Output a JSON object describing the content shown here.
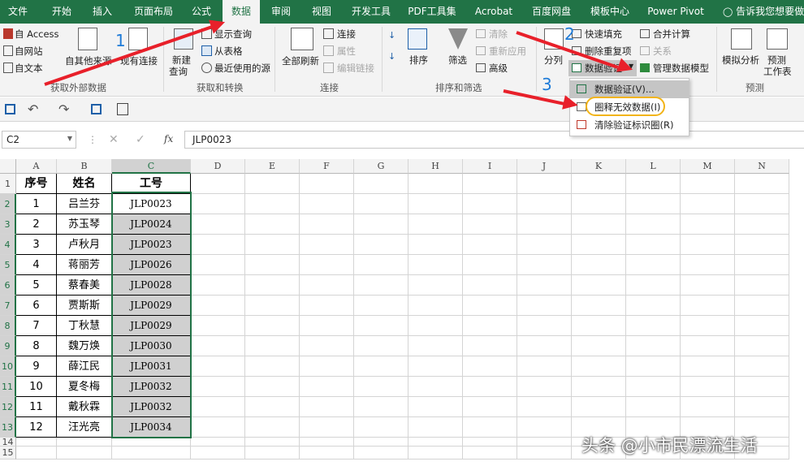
{
  "tabs": [
    "文件",
    "开始",
    "插入",
    "页面布局",
    "公式",
    "数据",
    "审阅",
    "视图",
    "开发工具",
    "PDF工具集",
    "Acrobat",
    "百度网盘",
    "模板中心",
    "Power Pivot",
    "告诉我您想要做什"
  ],
  "ribbon": {
    "access": "自 Access",
    "web": "自网站",
    "text": "自文本",
    "other_sources": "自其他来源",
    "existing_conn": "现有连接",
    "group_external": "获取外部数据",
    "new_query": "新建",
    "new_query2": "查询",
    "show_query": "显示查询",
    "from_table": "从表格",
    "recent_sources": "最近使用的源",
    "group_transform": "获取和转换",
    "refresh_all": "全部刷新",
    "connections": "连接",
    "properties": "属性",
    "edit_links": "编辑链接",
    "group_connections": "连接",
    "sort": "排序",
    "filter": "筛选",
    "clear": "清除",
    "reapply": "重新应用",
    "advanced": "高级",
    "group_sort_filter": "排序和筛选",
    "split": "分列",
    "flash_fill": "快速填充",
    "remove_dup": "删除重复项",
    "data_validation": "数据验证",
    "consolidate": "合并计算",
    "relationships": "关系",
    "manage_model": "管理数据模型",
    "what_if": "模拟分析",
    "forecast": "预测",
    "forecast_sheet": "工作表",
    "group_forecast": "预测"
  },
  "dropdown": {
    "item1": "数据验证(V)...",
    "item2": "圈释无效数据(I)",
    "item3": "清除验证标识圈(R)"
  },
  "formula_bar": {
    "name_box": "C2",
    "fx": "fx",
    "value": "JLP0023"
  },
  "columns": [
    "A",
    "B",
    "C",
    "D",
    "E",
    "F",
    "G",
    "H",
    "I",
    "J",
    "K",
    "L",
    "M",
    "N"
  ],
  "rows": [
    "1",
    "2",
    "3",
    "4",
    "5",
    "6",
    "7",
    "8",
    "9",
    "10",
    "11",
    "12",
    "13",
    "14",
    "15"
  ],
  "table": {
    "headers": [
      "序号",
      "姓名",
      "工号"
    ],
    "data": [
      [
        "1",
        "吕兰芬",
        "JLP0023"
      ],
      [
        "2",
        "苏玉琴",
        "JLP0024"
      ],
      [
        "3",
        "卢秋月",
        "JLP0023"
      ],
      [
        "4",
        "蒋丽芳",
        "JLP0026"
      ],
      [
        "5",
        "蔡春美",
        "JLP0028"
      ],
      [
        "6",
        "贾斯斯",
        "JLP0029"
      ],
      [
        "7",
        "丁秋慧",
        "JLP0029"
      ],
      [
        "8",
        "魏万焕",
        "JLP0030"
      ],
      [
        "9",
        "薛江民",
        "JLP0031"
      ],
      [
        "10",
        "夏冬梅",
        "JLP0032"
      ],
      [
        "11",
        "戴秋霖",
        "JLP0032"
      ],
      [
        "12",
        "汪光亮",
        "JLP0034"
      ]
    ]
  },
  "steps": [
    "1",
    "2",
    "3"
  ],
  "watermark": "头条 @小市民漂流生活",
  "colors": {
    "excel_green": "#217346",
    "arrow_red": "#e8202a",
    "step_blue": "#1e7bd8",
    "highlight_circle": "#f2b418"
  }
}
